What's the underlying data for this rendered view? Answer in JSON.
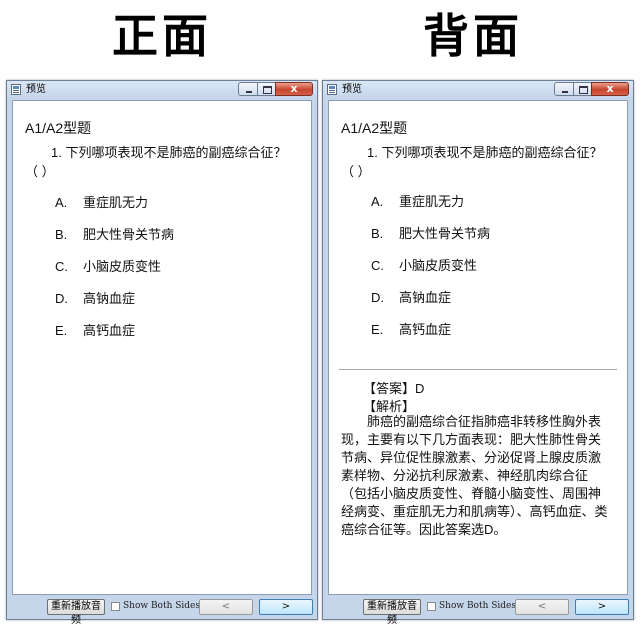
{
  "headings": {
    "front": "正面",
    "back": "背面"
  },
  "window": {
    "title": "预览",
    "close_symbol": "x"
  },
  "question": {
    "type": "A1/A2型题",
    "text": "1. 下列哪项表现不是肺癌的副癌综合征？（        ）",
    "options": [
      {
        "letter": "A.",
        "text": "重症肌无力"
      },
      {
        "letter": "B.",
        "text": "肥大性骨关节病"
      },
      {
        "letter": "C.",
        "text": "小脑皮质变性"
      },
      {
        "letter": "D.",
        "text": "高钠血症"
      },
      {
        "letter": "E.",
        "text": "高钙血症"
      }
    ]
  },
  "answer": {
    "answer_line": "【答案】D",
    "analysis_label": "【解析】",
    "analysis_text": "肺癌的副癌综合征指肺癌非转移性胸外表现，主要有以下几方面表现：肥大性肺性骨关节病、异位促性腺激素、分泌促肾上腺皮质激素样物、分泌抗利尿激素、神经肌肉综合征（包括小脑皮质变性、脊髓小脑变性、周围神经病变、重症肌无力和肌病等）、高钙血症、类癌综合征等。因此答案选D。"
  },
  "footer": {
    "replay_label": "重新播放音频",
    "show_both_label": "Show Both Sides",
    "prev_label": "<",
    "next_label": ">"
  },
  "colors": {
    "window_frame": "#c6d6ea",
    "close_button": "#c7452d",
    "next_button_border": "#3c7fb1"
  }
}
